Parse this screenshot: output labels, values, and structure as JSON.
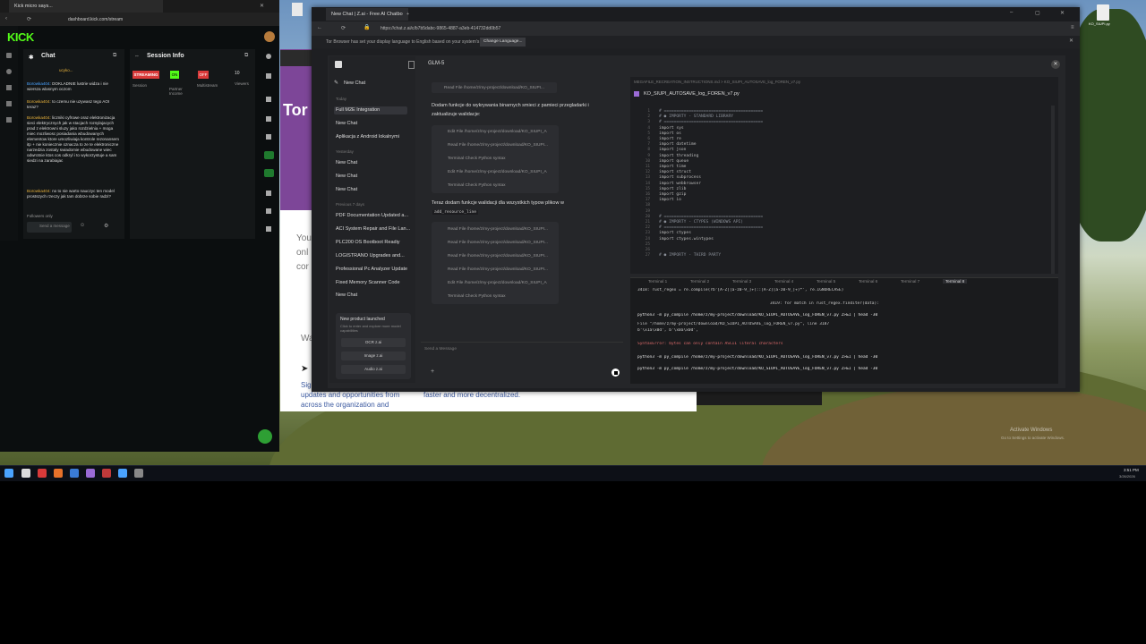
{
  "kick": {
    "tab_title": "Kick micro says...",
    "url": "dashboard.kick.com/stream",
    "logo": "KICK",
    "chat_title": "Chat",
    "session_title": "Session Info",
    "pinned_user": "ucyko...",
    "badges": [
      "STREAMING",
      "ON",
      "OFF"
    ],
    "badge_labels": [
      "Session",
      "Partner Income",
      "Multistream"
    ],
    "viewers_value": "10",
    "viewers_label": "Viewers",
    "messages": [
      {
        "user": "Borowka404:",
        "text": "DOKLADNIE lustrie widza i nie wiersza wlasnym oczom"
      },
      {
        "user": "Borowka404:",
        "text": "to czemu nie uzywasz tego AOI teraz?"
      },
      {
        "user": "Borowka404:",
        "text": "liczniki cyfrowe oraz elektronizacja sieci elektrycznych jak w stacjach rozsylajacych prad z elektrowni sluzy jako rozdzielnia + moga miec mozliwosc posiadania wbudowanych elementow ktore umozliwiaja kontrole rezonansem itp + nie koniecznie oznacza to ze te elektroniczne narzedzia zostaly swiadomie wbudowane wiec odwrotnie ktos cos odkryl i to wykorzystuje a sam siedzi na zarabiajac"
      },
      {
        "user": "Borowka404:",
        "text": "no to nie warto nauczyc ten model prostszych rzeczy jak tam dobrze sobie radzi?"
      }
    ],
    "followers_only": "Followers only",
    "send_placeholder": "Send a message"
  },
  "zai": {
    "tabs": [
      "New Chat | Z.ai - Free AI Chatbo",
      "+"
    ],
    "url": "https://chat.z.ai/c/b7b5dabc-9865-4887-a3eb-414732dd0b57",
    "notice": "Tor Browser has set your display language to English based on your system's language.",
    "notice_button": "Change Language...",
    "model": "GLM-5",
    "new_chat": "New Chat",
    "sidebar_groups": [
      "Today",
      "Yesterday",
      "Previous 7 days"
    ],
    "chats_today": [
      "Full M2E Integration",
      "New Chat",
      "Aplikacja z Android lokalnymi"
    ],
    "chats_yesterday": [
      "New Chat",
      "New Chat",
      "New Chat"
    ],
    "chats_prev": [
      "PDF Documentation Updated a...",
      "ACI System Repair and File Lan...",
      "PLC200 OS Bootboot Readiy",
      "LOGISTRANO Upgrades and...",
      "Professional Pc Analyzer Update",
      "Fixed Memory Scanner Code",
      "New Chat"
    ],
    "promo_title": "New product launched",
    "promo_text": "Click to enter and explore more model capabilities",
    "promo_items": [
      "OCR z.ai",
      "Image z.ai",
      "Audio z.ai"
    ],
    "assistant_text_1": "Dodam funkcje do wykrywania binarnych smieci z pamieci przegladarki i zaktualizuje walidacje:",
    "assistant_text_2": "Teraz dodam funkcje walidacji dla wszystkich typow plikow w",
    "inline_code": "add_resource_line",
    "steps_top": [
      "Read File   /home/z/my-project/download/KO_SIUPI...",
      "Edit File   /home/z/my-project/download/KO_SIUPI_A",
      "Read File   /home/z/my-project/download/KO_SIUPI...",
      "Terminal    Check Python syntax",
      "Edit File   /home/z/my-project/download/KO_SIUPI_A",
      "Terminal    Check Python syntax"
    ],
    "steps_bottom": [
      "Read File   /home/z/my-project/download/KO_SIUPI...",
      "Read File   /home/z/my-project/download/KO_SIUPI...",
      "Read File   /home/z/my-project/download/KO_SIUPI...",
      "Read File   /home/z/my-project/download/KO_SIUPI...",
      "Edit File   /home/z/my-project/download/KO_SIUPI_A",
      "Terminal    Check Python syntax"
    ],
    "input_placeholder": "Send a Message",
    "file_breadcrumb": "MEGAFILE_RECREATION_INSTRUCTIONS.md  >  KO_SIUPI_AUTOSAVE_log_FOREN_v7.py",
    "file_name": "KO_SIUPI_AUTOSAVE_log_FOREN_v7.py",
    "code_lines": [
      "# ========================================",
      "# ● IMPORTY - STANDARD LIBRARY",
      "# ========================================",
      "import sys",
      "import os",
      "import re",
      "import datetime",
      "import json",
      "import threading",
      "import queue",
      "import time",
      "import struct",
      "import subprocess",
      "import webbrowser",
      "import zlib",
      "import gzip",
      "import io",
      "",
      "",
      "# ========================================",
      "# ● IMPORTY - CTYPES (WINDOWS API)",
      "# ========================================",
      "import ctypes",
      "import ctypes.wintypes",
      "",
      "",
      "# ● IMPORTY - THIRD PARTY"
    ],
    "terminal_tabs": [
      "Terminal 1",
      "Terminal 2",
      "Terminal 3",
      "Terminal 4",
      "Terminal 5",
      "Terminal 6",
      "Terminal 7",
      "Terminal 8"
    ],
    "terminal_lines": [
      "3418:          rust_regex = re.compile(rb'[A-Z][a-z0-9_]+(::[A-Z][a-z0-9_]+)*', re.IGNORECASE)",
      "3419:                          for match in rust_regex.finditer(data):",
      "python3 -m py_compile /home/z/my-project/download/KO_SIUPI_AUTOSAVE_log_FOREN_v7.py 2>&1 | head -30",
      "  File \"/home/z/my-project/download/KO_SIUPI_AUTOSAVE_log_FOREN_v7.py\", line 3187",
      "    b'\\x1a\\x0d', b'\\x0a\\x0d',",
      "SyntaxError: bytes can only contain ASCII literal characters",
      "python3 -m py_compile /home/z/my-project/download/KO_SIUPI_AUTOSAVE_log_FOREN_v7.py 2>&1 | head -30",
      "python3 -m py_compile /home/z/my-project/download/KO_SIUPI_AUTOSAVE_log_FOREN_v7.py 2>&1 | head -30"
    ]
  },
  "behind_page": {
    "logo": "Tor",
    "text_1": "You",
    "text_2": "onl",
    "text_3": "cor",
    "text_4": "Wa",
    "sign": "Sig",
    "line_a": "updates and opportunities from",
    "line_b": "across the organization and",
    "line_c": "faster and more decentralized."
  },
  "desktop": {
    "watermark_1": "Activate Windows",
    "watermark_2": "Go to Settings to activate Windows.",
    "clock": "3:51 PM",
    "date": "3/26/2026",
    "file_label": "KO_SIUPI.py"
  },
  "colors": {
    "kick_green": "#53fc18",
    "accent_red": "#d93a3a",
    "zai_bg": "#1e1f22"
  }
}
